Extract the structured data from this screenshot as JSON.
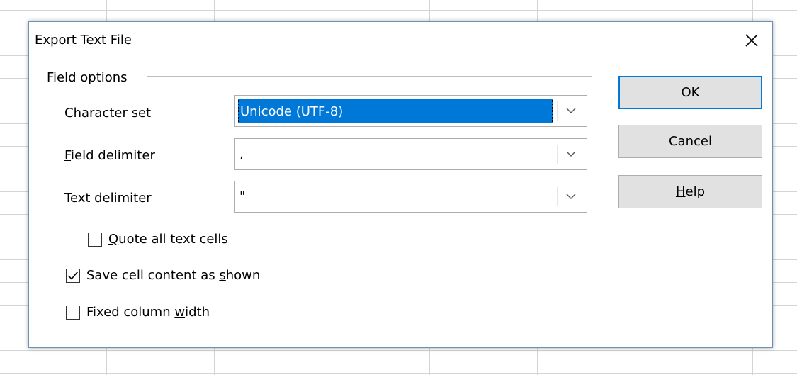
{
  "dialog": {
    "title": "Export Text File",
    "close_glyph": "✕"
  },
  "field_options": {
    "group_label": "Field options",
    "character_set": {
      "label_first": "C",
      "label_rest": "haracter set",
      "value": "Unicode (UTF-8)"
    },
    "field_delimiter": {
      "label_first": "F",
      "label_rest": "ield delimiter",
      "value": ","
    },
    "text_delimiter": {
      "label_first": "T",
      "label_rest": "ext delimiter",
      "value": "\""
    },
    "quote_all": {
      "label_first": "Q",
      "label_rest": "uote all text cells",
      "checked": false
    },
    "save_as_shown": {
      "label_pre": "Save cell content as ",
      "label_key": "s",
      "label_post": "hown",
      "checked": true
    },
    "fixed_width": {
      "label_pre": "Fixed column ",
      "label_key": "w",
      "label_post": "idth",
      "checked": false
    }
  },
  "buttons": {
    "ok": "OK",
    "cancel": "Cancel",
    "help_key": "H",
    "help_rest": "elp"
  },
  "icons": {
    "combo_arrow": "chevron-down-icon",
    "checkmark": "checkmark-icon",
    "close": "close-icon"
  }
}
